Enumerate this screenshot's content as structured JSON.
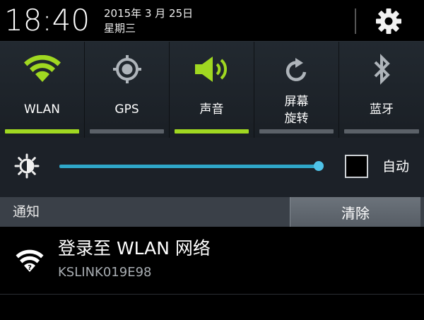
{
  "status_bar": {
    "time": "18:40",
    "date": "2015年 3 月 25日",
    "weekday": "星期三",
    "settings_icon": "gear-icon"
  },
  "quick_toggles": [
    {
      "label": "WLAN",
      "icon": "wifi-icon",
      "active": true
    },
    {
      "label": "GPS",
      "icon": "gps-icon",
      "active": false
    },
    {
      "label": "声音",
      "icon": "sound-icon",
      "active": true
    },
    {
      "label_line1": "屏幕",
      "label_line2": "旋转",
      "icon": "rotate-icon",
      "active": false
    },
    {
      "label": "蓝牙",
      "icon": "bluetooth-icon",
      "active": false
    }
  ],
  "brightness": {
    "icon": "brightness-icon",
    "level_fraction": 0.95,
    "auto_label": "自动",
    "auto_checked": false
  },
  "notifications_header": {
    "title": "通知",
    "clear_label": "清除"
  },
  "notifications": [
    {
      "icon": "wifi-question-icon",
      "title": "登录至 WLAN 网络",
      "subtitle": "KSLINK019E98"
    }
  ],
  "colors": {
    "active_accent": "#a0d821",
    "slider": "#2fa7c9",
    "panel_bg": "#1c2128"
  }
}
